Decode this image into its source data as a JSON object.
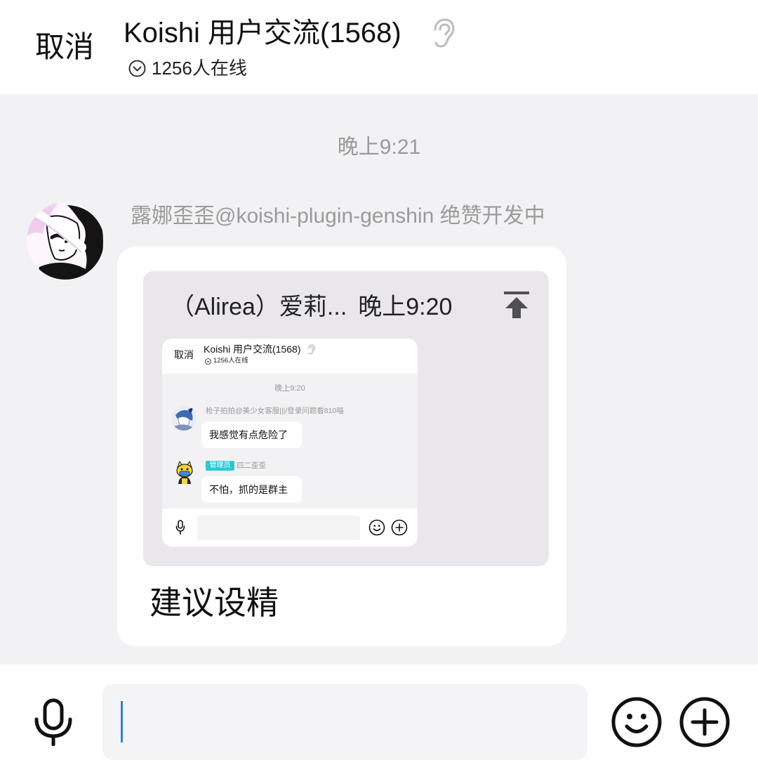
{
  "header": {
    "cancel_label": "取消",
    "title": "Koishi 用户交流(1568)",
    "online_count_text": "1256人在线"
  },
  "chat": {
    "timestamp": "晚上9:21",
    "message": {
      "sender_name": "露娜歪歪@koishi-plugin-genshin 绝赞开发中",
      "forward": {
        "author": "（Alirea）爱莉...",
        "time": "晚上9:20",
        "screenshot": {
          "cancel_label": "取消",
          "title": "Koishi 用户交流(1568)",
          "online_count_text": "1256人在线",
          "timestamp": "晚上9:20",
          "messages": [
            {
              "sender_name": "枪子拍拍@美少女客服|||/登录问题看810喵",
              "text": "我感觉有点危险了"
            },
            {
              "badge": "管理员",
              "sender_name": "四二歪歪",
              "text": "不怕，抓的是群主"
            }
          ]
        }
      },
      "text": "建议设精"
    }
  },
  "composer": {
    "input_value": ""
  },
  "icons": {
    "header_status": "ear-icon",
    "online_toggle": "chevron-down-circle-icon",
    "jump_to_message": "scroll-to-top-icon",
    "voice": "microphone-icon",
    "emoji": "smiley-icon",
    "more": "plus-circle-icon"
  },
  "colors": {
    "chat_background": "#f2f1f3",
    "bubble": "#ffffff",
    "quote_box": "#e9e7eb",
    "secondary_text": "#9b9b9b",
    "cursor": "#2f7fe6",
    "admin_badge": "#29c9d6"
  }
}
